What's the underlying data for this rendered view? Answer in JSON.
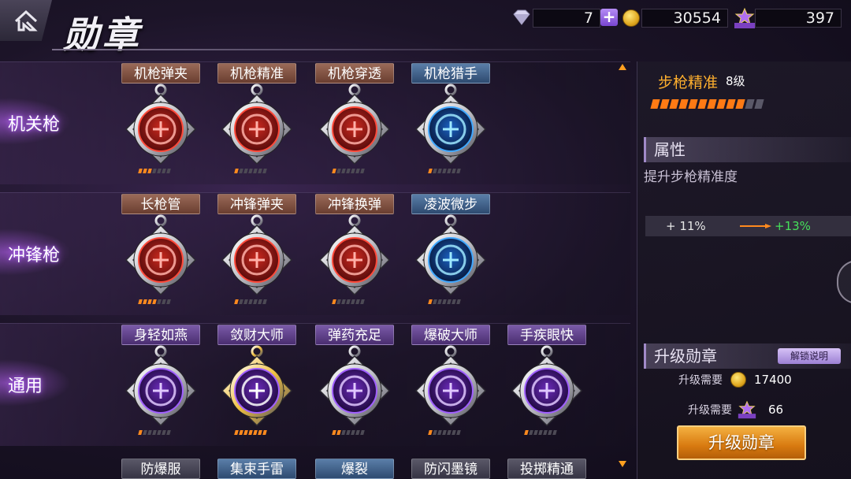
{
  "header": {
    "title": "勋章",
    "gems": "7",
    "coins": "30554",
    "merit_points": "397",
    "merit_icon_label": "功勋点"
  },
  "categories": [
    {
      "label": "机关枪",
      "medals": [
        {
          "name": "机枪弹夹",
          "icon": "magazine-icon",
          "color": "red",
          "level": 3,
          "max": 7
        },
        {
          "name": "机枪精准",
          "icon": "crosshair-gun-icon",
          "color": "red",
          "level": 1,
          "max": 7
        },
        {
          "name": "机枪穿透",
          "icon": "piercing-bullet-icon",
          "color": "red",
          "level": 1,
          "max": 7
        },
        {
          "name": "机枪猎手",
          "icon": "machine-gun-icon",
          "color": "blue",
          "level": 1,
          "max": 7
        }
      ]
    },
    {
      "label": "冲锋枪",
      "medals": [
        {
          "name": "长枪管",
          "icon": "long-barrel-icon",
          "color": "red",
          "level": 4,
          "max": 11
        },
        {
          "name": "冲锋弹夹",
          "icon": "magazine-icon",
          "color": "red",
          "level": 1,
          "max": 7
        },
        {
          "name": "冲锋换弹",
          "icon": "reload-icon",
          "color": "red",
          "level": 1,
          "max": 7
        },
        {
          "name": "凌波微步",
          "icon": "legs-icon",
          "color": "blue",
          "level": 1,
          "max": 7
        }
      ]
    },
    {
      "label": "通用",
      "medals": [
        {
          "name": "身轻如燕",
          "icon": "feather-icon",
          "color": "purple",
          "level": 1,
          "max": 7
        },
        {
          "name": "敛财大师",
          "icon": "money-bag-icon",
          "color": "gold",
          "level": 7,
          "max": 7
        },
        {
          "name": "弹药充足",
          "icon": "ammo-icon",
          "color": "purple",
          "level": 2,
          "max": 7
        },
        {
          "name": "爆破大师",
          "icon": "rpg-icon",
          "color": "purple",
          "level": 1,
          "max": 7
        },
        {
          "name": "手疾眼快",
          "icon": "hand-gun-icon",
          "color": "purple",
          "level": 1,
          "max": 7
        }
      ]
    }
  ],
  "partial_row": [
    "防爆服",
    "集束手雷",
    "爆裂",
    "防闪墨镜",
    "投掷精通"
  ],
  "detail": {
    "name": "步枪精准",
    "level_text": "8级",
    "level": 8,
    "max_level": 10,
    "attr_header": "属性",
    "attr_desc": "提升步枪精准度",
    "attr_current": "+ 11%",
    "attr_next": "+13%",
    "upgrade_header": "升级勋章",
    "unlock_info": "解锁说明",
    "req_coin_label": "升级需要",
    "req_coin_value": "17400",
    "req_merit_label": "升级需要",
    "req_merit_value": "66",
    "upgrade_button": "升级勋章"
  },
  "colors": {
    "accent_orange": "#ff8a1e",
    "next_value_green": "#46e05a",
    "selected_name": "#ffb02e"
  }
}
